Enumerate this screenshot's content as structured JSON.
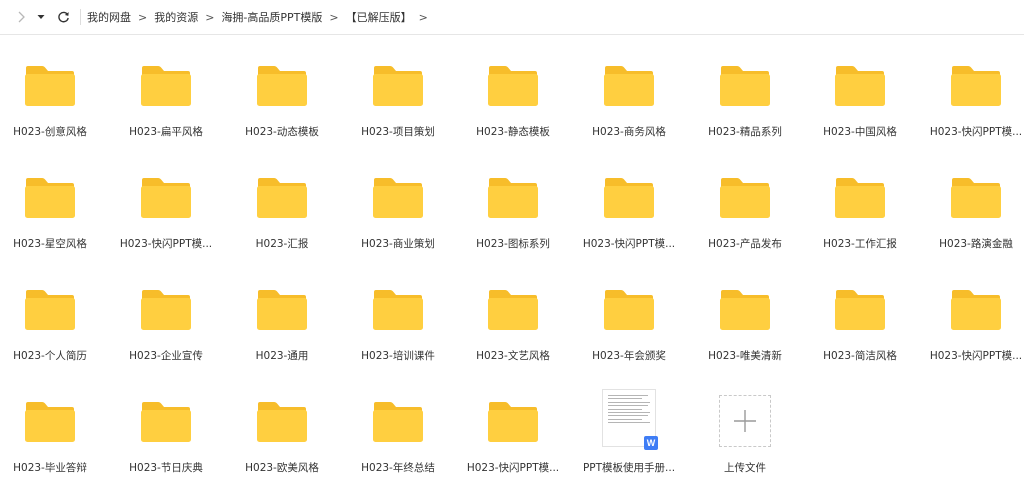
{
  "breadcrumb": [
    "我的网盘",
    "我的资源",
    "海拥-高品质PPT模版",
    "【已解压版】"
  ],
  "breadcrumb_sep": ">",
  "folder_color": "#ffcf40",
  "folder_tab_color": "#f7bd2a",
  "rows": [
    [
      "H023-创意风格",
      "H023-扁平风格",
      "H023-动态模板",
      "H023-项目策划",
      "H023-静态模板",
      "H023-商务风格",
      "H023-精品系列",
      "H023-中国风格",
      "H023-快闪PPT模..."
    ],
    [
      "H023-星空风格",
      "H023-快闪PPT模...",
      "H023-汇报",
      "H023-商业策划",
      "H023-图标系列",
      "H023-快闪PPT模...",
      "H023-产品发布",
      "H023-工作汇报",
      "H023-路演金融"
    ],
    [
      "H023-个人简历",
      "H023-企业宣传",
      "H023-通用",
      "H023-培训课件",
      "H023-文艺风格",
      "H023-年会颁奖",
      "H023-唯美清新",
      "H023-简洁风格",
      "H023-快闪PPT模..."
    ],
    [
      "H023-毕业答辩",
      "H023-节日庆典",
      "H023-欧美风格",
      "H023-年终总结",
      "H023-快闪PPT模..."
    ]
  ],
  "document_file": {
    "label": "PPT模板使用手册...",
    "badge": "W"
  },
  "upload": {
    "label": "上传文件"
  }
}
